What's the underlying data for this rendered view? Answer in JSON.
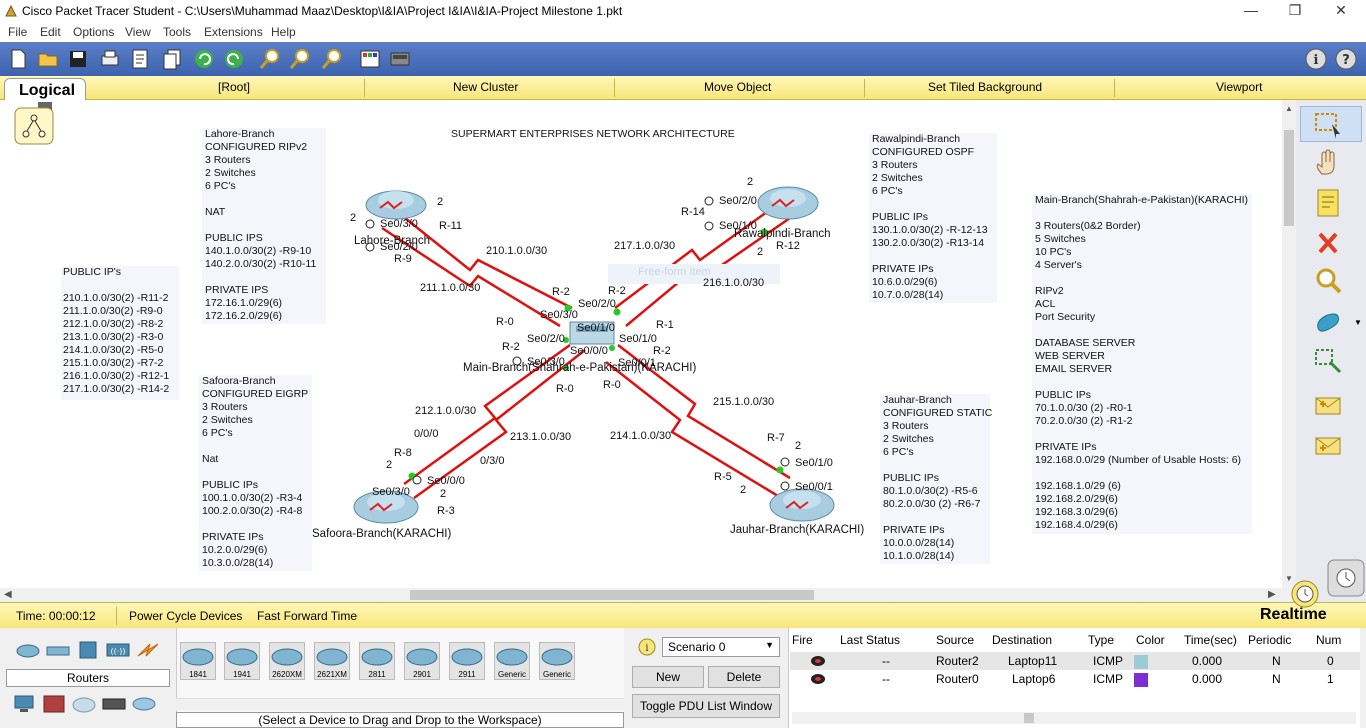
{
  "window": {
    "title": "Cisco Packet Tracer Student - C:\\Users\\Muhammad Maaz\\Desktop\\I&IA\\Project I&IA\\I&IA-Project Milestone 1.pkt",
    "minimize": "—",
    "restore": "❐",
    "close": "✕"
  },
  "menu": [
    "File",
    "Edit",
    "Options",
    "View",
    "Tools",
    "Extensions",
    "Help"
  ],
  "nav": {
    "logical": "Logical",
    "root": "[Root]",
    "new_cluster": "New Cluster",
    "move_object": "Move Object",
    "set_bg": "Set Tiled Background",
    "viewport": "Viewport"
  },
  "diagram": {
    "title": "SUPERMART ENTERPRISES NETWORK ARCHITECTURE",
    "watermark": "Free-form Item",
    "public_ips_note": "PUBLIC IP's\n\n210.1.0.0/30(2) -R11-2\n211.1.0.0/30(2) -R9-0\n212.1.0.0/30(2) -R8-2\n213.1.0.0/30(2) -R3-0\n214.1.0.0/30(2) -R5-0\n215.1.0.0/30(2) -R7-2\n216.1.0.0/30(2) -R12-1\n217.1.0.0/30(2) -R14-2",
    "lahore_note": "Lahore-Branch\nCONFIGURED RIPv2\n3 Routers\n2 Switches\n6 PC's\n\nNAT\n\nPUBLIC IPS\n140.1.0.0/30(2) -R9-10\n140.2.0.0/30(2) -R10-11\n\nPRIVATE IPS\n172.16.1.0/29(6)\n172.16.2.0/29(6)",
    "safoora_note": "Safoora-Branch\nCONFIGURED EIGRP\n3 Routers\n2 Switches\n6 PC's\n\nNat\n\nPUBLIC IPs\n100.1.0.0/30(2) -R3-4\n100.2.0.0/30(2) -R4-8\n\nPRIVATE IPs\n10.2.0.0/29(6)\n10.3.0.0/28(14)",
    "rawalpindi_note": "Rawalpindi-Branch\nCONFIGURED OSPF\n3 Routers\n2 Switches\n6 PC's\n\nPUBLIC IPs\n130.1.0.0/30(2) -R-12-13\n130.2.0.0/30(2) -R13-14\n\nPRIVATE IPs\n10.6.0.0/29(6)\n10.7.0.0/28(14)",
    "jauhar_note": "Jauhar-Branch\nCONFIGURED STATIC\n3 Routers\n2 Switches\n6 PC's\n\nPUBLIC IPs\n80.1.0.0/30(2) -R5-6\n80.2.0.0/30 (2) -R6-7\n\nPRIVATE IPs\n10.0.0.0/28(14)\n10.1.0.0/28(14)",
    "main_note": "Main-Branch(Shahrah-e-Pakistan)(KARACHI)\n\n3 Routers(0&2 Border)\n5 Switches\n10 PC's\n4 Server's\n\nRIPv2\nACL\nPort Security\n\nDATABASE SERVER\nWEB SERVER\nEMAIL SERVER\n\nPUBLIC IPs\n70.1.0.0/30 (2) -R0-1\n70.2.0.0/30 (2) -R1-2\n\nPRIVATE IPs\n192.168.0.0/29 (Number of Usable Hosts: 6)\n\n192.168.1.0/29 (6)\n192.168.2.0/29(6)\n192.168.3.0/29(6)\n192.168.4.0/29(6)",
    "devices": {
      "lahore": "Lahore-Branch",
      "rawalpindi": "Rawalpindi-Branch",
      "main": "Main-Branch(Shahrah-e-Pakistan)(KARACHI)",
      "safoora": "Safoora-Branch(KARACHI)",
      "jauhar": "Jauhar-Branch(KARACHI)"
    },
    "labels": {
      "l_2a": "2",
      "l_2b": "2",
      "l_se030": "Se0/3/0",
      "l_r11": "R-11",
      "l_se020": "Se0/2/0",
      "l_r9": "R-9",
      "net_210": "210.1.0.0/30",
      "net_211": "211.1.0.0/30",
      "r_2": "2",
      "r_r14": "R-14",
      "r_se020": "Se0/2/0",
      "r_se010": "Se0/1/0",
      "r_r12": "R-12",
      "r_2b": "2",
      "net_217": "217.1.0.0/30",
      "net_216": "216.1.0.0/30",
      "m_r2a": "R-2",
      "m_se030": "Se0/3/0",
      "m_r0a": "R-0",
      "m_se020a": "Se0/2/0",
      "m_r2b": "R-2",
      "m_se020b": "Se0/2/0",
      "m_r2c": "R-2",
      "m_se010a": "Se0/1/0",
      "m_r1": "R-1",
      "m_se010b": "Se0/1/0",
      "m_r2d": "R-2",
      "m_se000": "Se0/0/0",
      "m_se030b": "Se0/3/0",
      "m_se001": "Se0/0/1",
      "m_r0b": "R-0",
      "m_r0c": "R-0",
      "net_212": "212.1.0.0/30",
      "net_213": "213.1.0.0/30",
      "net_214": "214.1.0.0/30",
      "net_215": "215.1.0.0/30",
      "s_000": "0/0/0",
      "s_030": "0/3/0",
      "s_r8": "R-8",
      "s_2a": "2",
      "s_se030": "Se0/3/0",
      "s_se000": "Se0/0/0",
      "s_2b": "2",
      "s_r3": "R-3",
      "j_r7": "R-7",
      "j_2a": "2",
      "j_se010": "Se0/1/0",
      "j_r5": "R-5",
      "j_2b": "2",
      "j_se001": "Se0/0/1"
    }
  },
  "timebar": {
    "time": "Time: 00:00:12",
    "power": "Power Cycle Devices",
    "fast": "Fast Forward Time",
    "mode": "Realtime"
  },
  "bottom": {
    "category": "Routers",
    "hint": "(Select a Device to Drag and Drop to the Workspace)",
    "routers": [
      "1841",
      "1941",
      "2620XM",
      "2621XM",
      "2811",
      "2901",
      "2911",
      "Generic",
      "Generic"
    ],
    "scenario": "Scenario 0",
    "new_btn": "New",
    "delete_btn": "Delete",
    "toggle_btn": "Toggle PDU List Window",
    "pdu_headers": [
      "Fire",
      "Last Status",
      "Source",
      "Destination",
      "Type",
      "Color",
      "Time(sec)",
      "Periodic",
      "Num"
    ],
    "pdu_rows": [
      {
        "status": "--",
        "source": "Router2",
        "dest": "Laptop11",
        "type": "ICMP",
        "color": "#9ec9d6",
        "time": "0.000",
        "periodic": "N",
        "num": "0"
      },
      {
        "status": "--",
        "source": "Router0",
        "dest": "Laptop6",
        "type": "ICMP",
        "color": "#7b2fd3",
        "time": "0.000",
        "periodic": "N",
        "num": "1"
      }
    ]
  },
  "colors": {
    "link": "#e01010",
    "port_up": "#22cc22",
    "nav_bg": "#f8e67a",
    "toolbar_bg": "#3d63b0"
  }
}
